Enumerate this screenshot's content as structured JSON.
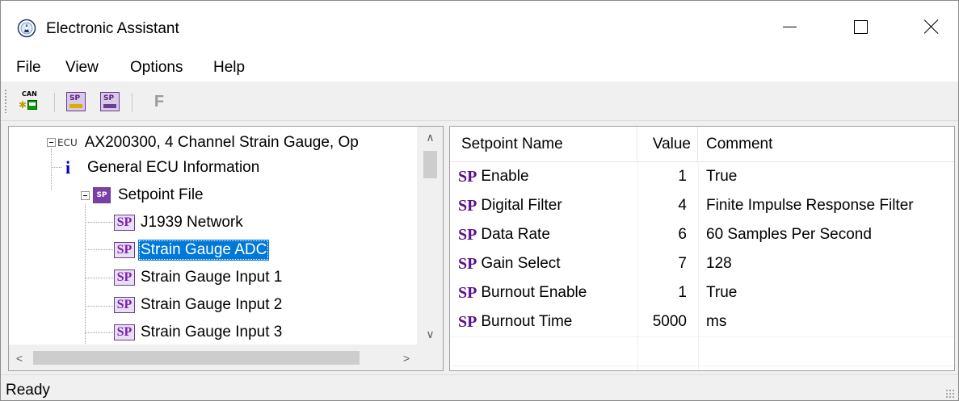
{
  "window": {
    "title": "Electronic Assistant"
  },
  "menu": {
    "items": [
      "File",
      "View",
      "Options",
      "Help"
    ]
  },
  "toolbar": {
    "buttons": [
      {
        "icon": "can-network-icon"
      },
      {
        "icon": "setpoint-file-open-icon"
      },
      {
        "icon": "setpoint-file-save-icon"
      },
      {
        "icon": "flash-icon",
        "label": "F"
      }
    ]
  },
  "tree": {
    "ecu_tag": "ECU",
    "root_label": "AX200300, 4 Channel Strain Gauge, Op",
    "info_glyph": "i",
    "info_label": "General ECU Information",
    "setpoint_file_tag": "SP",
    "setpoint_file_label": "Setpoint File",
    "sp_glyph": "SP",
    "children": [
      {
        "label": "J1939 Network",
        "selected": false
      },
      {
        "label": "Strain Gauge ADC",
        "selected": true
      },
      {
        "label": "Strain Gauge Input 1",
        "selected": false
      },
      {
        "label": "Strain Gauge Input 2",
        "selected": false
      },
      {
        "label": "Strain Gauge Input 3",
        "selected": false
      }
    ]
  },
  "table": {
    "columns": [
      "Setpoint Name",
      "Value",
      "Comment"
    ],
    "sp_glyph": "SP",
    "rows": [
      {
        "name": "Enable",
        "value": "1",
        "comment": "True"
      },
      {
        "name": "Digital Filter",
        "value": "4",
        "comment": "Finite Impulse Response Filter"
      },
      {
        "name": "Data Rate",
        "value": "6",
        "comment": "60 Samples Per Second"
      },
      {
        "name": "Gain Select",
        "value": "7",
        "comment": "128"
      },
      {
        "name": "Burnout Enable",
        "value": "1",
        "comment": "True"
      },
      {
        "name": "Burnout Time",
        "value": "5000",
        "comment": "ms"
      }
    ]
  },
  "status": {
    "text": "Ready"
  },
  "colors": {
    "selection": "#0078d7",
    "sp_purple": "#5a0e8c",
    "info_blue": "#0000c0"
  }
}
